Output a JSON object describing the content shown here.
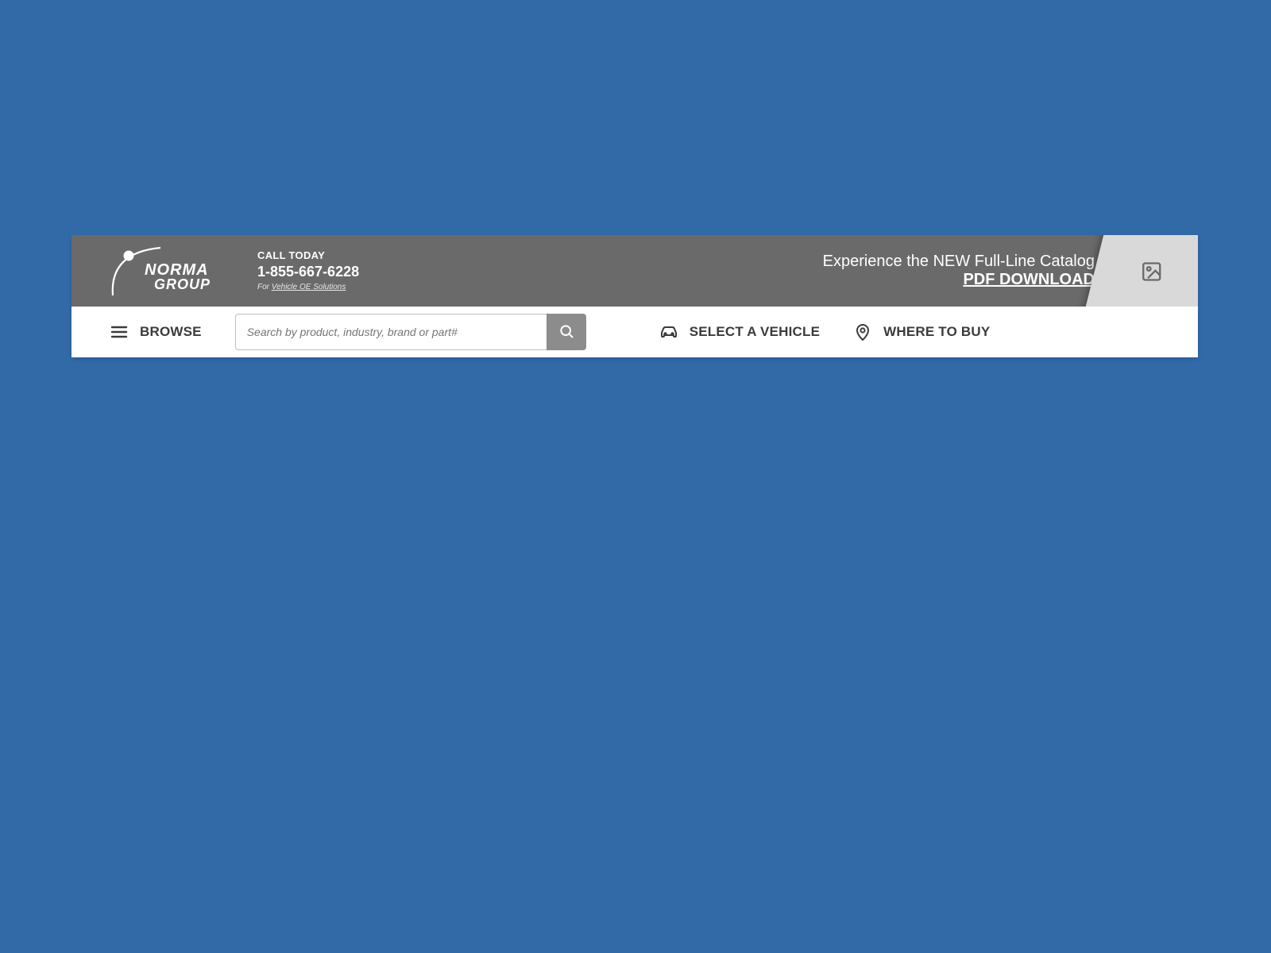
{
  "topbar": {
    "logo": {
      "line1": "NORMA",
      "line2": "GROUP"
    },
    "call": {
      "label": "CALL TODAY",
      "phone": "1-855-667-6228",
      "sub_prefix": "For ",
      "sub_link": "Vehicle OE Solutions"
    },
    "catalog": {
      "line1": "Experience the NEW Full-Line Catalog",
      "line2": "PDF DOWNLOAD"
    }
  },
  "nav": {
    "browse": "BROWSE",
    "search_placeholder": "Search by product, industry, brand or part#",
    "select_vehicle": "SELECT A VEHICLE",
    "where_to_buy": "WHERE TO BUY"
  }
}
